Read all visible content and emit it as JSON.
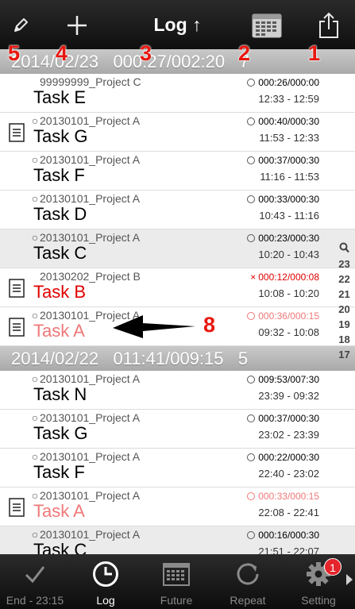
{
  "nav": {
    "title": "Log ↑",
    "icons": {
      "left1": "pencil-icon",
      "left2": "plus-icon",
      "right1": "calendar-icon",
      "right2": "share-icon"
    }
  },
  "annotations": [
    "5",
    "4",
    "3",
    "2",
    "1",
    "8"
  ],
  "sections": [
    {
      "header": "2014/02/23   000:27/002:20   7",
      "rows": [
        {
          "project": "99999999_Project C",
          "task": "Task E",
          "duration": "000:26/000:00",
          "time": "12:33 - 12:59"
        },
        {
          "project": "20130101_Project A",
          "task": "Task G",
          "duration": "000:40/000:30",
          "time": "11:53 - 12:33"
        },
        {
          "project": "20130101_Project A",
          "task": "Task F",
          "duration": "000:37/000:30",
          "time": "11:16 - 11:53"
        },
        {
          "project": "20130101_Project A",
          "task": "Task D",
          "duration": "000:33/000:30",
          "time": "10:43 - 11:16"
        },
        {
          "project": "20130101_Project A",
          "task": "Task C",
          "duration": "000:23/000:30",
          "time": "10:20 - 10:43"
        },
        {
          "project": "20130202_Project B",
          "task": "Task B",
          "duration": "000:12/000:08",
          "time": "10:08 - 10:20"
        },
        {
          "project": "20130101_Project A",
          "task": "Task A",
          "duration": "000:36/000:15",
          "time": "09:32 - 10:08"
        }
      ]
    },
    {
      "header": "2014/02/22   011:41/009:15   5",
      "rows": [
        {
          "project": "20130101_Project A",
          "task": "Task N",
          "duration": "009:53/007:30",
          "time": "23:39 - 09:32"
        },
        {
          "project": "20130101_Project A",
          "task": "Task G",
          "duration": "000:37/000:30",
          "time": "23:02 - 23:39"
        },
        {
          "project": "20130101_Project A",
          "task": "Task F",
          "duration": "000:22/000:30",
          "time": "22:40 - 23:02"
        },
        {
          "project": "20130101_Project A",
          "task": "Task A",
          "duration": "000:33/000:15",
          "time": "22:08 - 22:41"
        },
        {
          "project": "20130101_Project A",
          "task": "Task C",
          "duration": "000:16/000:30",
          "time": "21:51 - 22:07"
        }
      ]
    }
  ],
  "index": [
    "23",
    "22",
    "21",
    "20",
    "19",
    "18",
    "17"
  ],
  "index_icon": "search-icon",
  "colors": {
    "overrun_red": "#e00000",
    "completed_pink": "#f07878",
    "header_gray": "#b8b8b8",
    "annotation_red": "#e8170f"
  },
  "tabs": [
    {
      "label": "End - 23:15",
      "icon": "checkmark-icon"
    },
    {
      "label": "Log",
      "icon": "clock-icon"
    },
    {
      "label": "Future",
      "icon": "calendar-icon"
    },
    {
      "label": "Repeat",
      "icon": "repeat-icon"
    },
    {
      "label": "Setting",
      "icon": "gear-icon",
      "badge": "1"
    }
  ]
}
